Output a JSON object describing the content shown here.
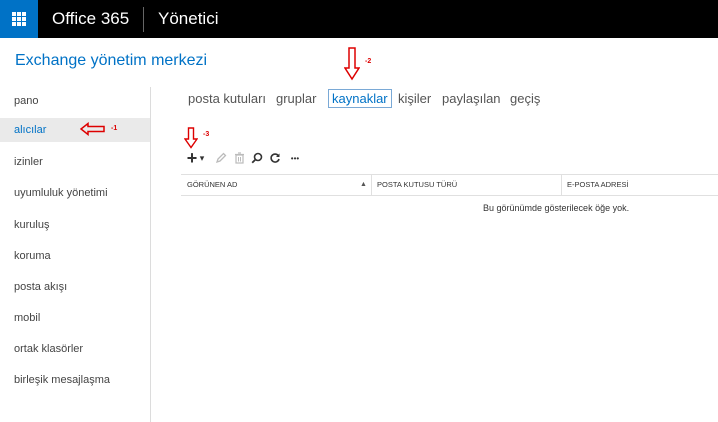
{
  "app": {
    "brand": "Office 365",
    "role": "Yönetici"
  },
  "page": {
    "title": "Exchange yönetim merkezi"
  },
  "sidebar": {
    "items": [
      {
        "label": "pano",
        "active": false
      },
      {
        "label": "alıcılar",
        "active": true
      },
      {
        "label": "izinler",
        "active": false
      },
      {
        "label": "uyumluluk yönetimi",
        "active": false
      },
      {
        "label": "kuruluş",
        "active": false
      },
      {
        "label": "koruma",
        "active": false
      },
      {
        "label": "posta akışı",
        "active": false
      },
      {
        "label": "mobil",
        "active": false
      },
      {
        "label": "ortak klasörler",
        "active": false
      },
      {
        "label": "birleşik mesajlaşma",
        "active": false
      }
    ]
  },
  "tabs": [
    {
      "label": "posta kutuları",
      "active": false
    },
    {
      "label": "gruplar",
      "active": false
    },
    {
      "label": "kaynaklar",
      "active": true
    },
    {
      "label": "kişiler",
      "active": false
    },
    {
      "label": "paylaşılan",
      "active": false
    },
    {
      "label": "geçiş",
      "active": false
    }
  ],
  "toolbar": {
    "add_icon": "plus-icon",
    "add_glyph": "+",
    "dropdown_glyph": "▾",
    "edit_icon": "pencil-icon",
    "delete_icon": "trash-icon",
    "search_icon": "search-icon",
    "refresh_icon": "refresh-icon",
    "more_icon": "more-icon",
    "more_glyph": "•••"
  },
  "table": {
    "columns": [
      "GÖRÜNEN AD",
      "POSTA KUTUSU TÜRÜ",
      "E-POSTA ADRESİ"
    ],
    "sort_glyph": "▲",
    "empty_message": "Bu görünümde gösterilecek öğe yok."
  },
  "annotations": [
    {
      "label": "-1",
      "direction": "left"
    },
    {
      "label": "-2",
      "direction": "down"
    },
    {
      "label": "-3",
      "direction": "down"
    }
  ],
  "colors": {
    "accent": "#0072c6",
    "topbar": "#000000",
    "annotation": "#dd0000",
    "active_nav_bg": "#eaeaea"
  }
}
